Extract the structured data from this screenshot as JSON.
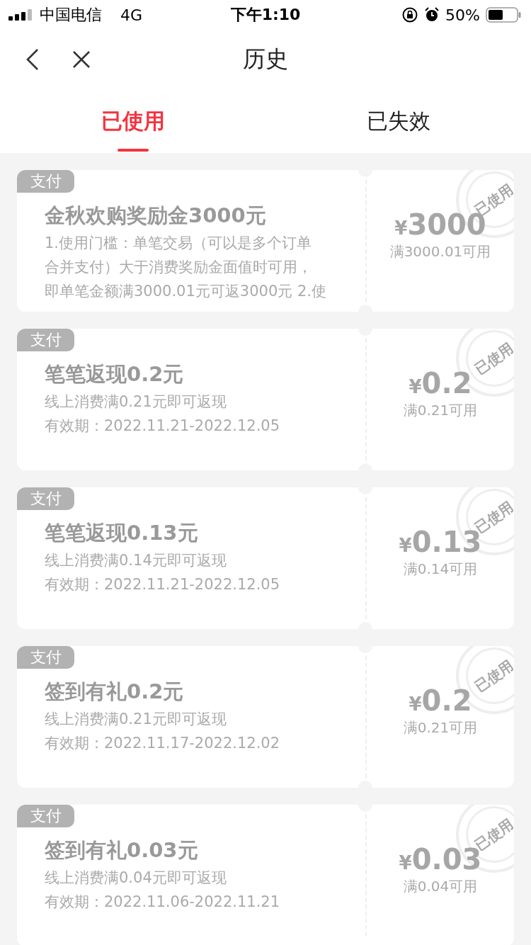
{
  "status_bar": {
    "carrier": "中国电信",
    "network": "4G",
    "time": "下午1:10",
    "battery_text": "50%"
  },
  "nav": {
    "title": "历史"
  },
  "tabs": [
    {
      "label": "已使用",
      "selected": true
    },
    {
      "label": "已失效",
      "selected": false
    }
  ],
  "coupons": [
    {
      "tag": "支付",
      "title": "金秋欢购奖励金3000元",
      "lines": [
        "1.使用门槛：单笔交易（可以是多个订单",
        "合并支付）大于消费奖励金面值时可用，",
        "即单笔金额满3000.01元可返3000元 2.使"
      ],
      "currency": "¥",
      "amount": "3000",
      "condition": "满3000.01可用",
      "stamp": "已使用"
    },
    {
      "tag": "支付",
      "title": "笔笔返现0.2元",
      "lines": [
        "线上消费满0.21元即可返现",
        "有效期：2022.11.21-2022.12.05"
      ],
      "currency": "¥",
      "amount": "0.2",
      "condition": "满0.21可用",
      "stamp": "已使用"
    },
    {
      "tag": "支付",
      "title": "笔笔返现0.13元",
      "lines": [
        "线上消费满0.14元即可返现",
        "有效期：2022.11.21-2022.12.05"
      ],
      "currency": "¥",
      "amount": "0.13",
      "condition": "满0.14可用",
      "stamp": "已使用"
    },
    {
      "tag": "支付",
      "title": "签到有礼0.2元",
      "lines": [
        "线上消费满0.21元即可返现",
        "有效期：2022.11.17-2022.12.02"
      ],
      "currency": "¥",
      "amount": "0.2",
      "condition": "满0.21可用",
      "stamp": "已使用"
    },
    {
      "tag": "支付",
      "title": "签到有礼0.03元",
      "lines": [
        "线上消费满0.04元即可返现",
        "有效期：2022.11.06-2022.11.21"
      ],
      "currency": "¥",
      "amount": "0.03",
      "condition": "满0.04可用",
      "stamp": "已使用"
    }
  ]
}
